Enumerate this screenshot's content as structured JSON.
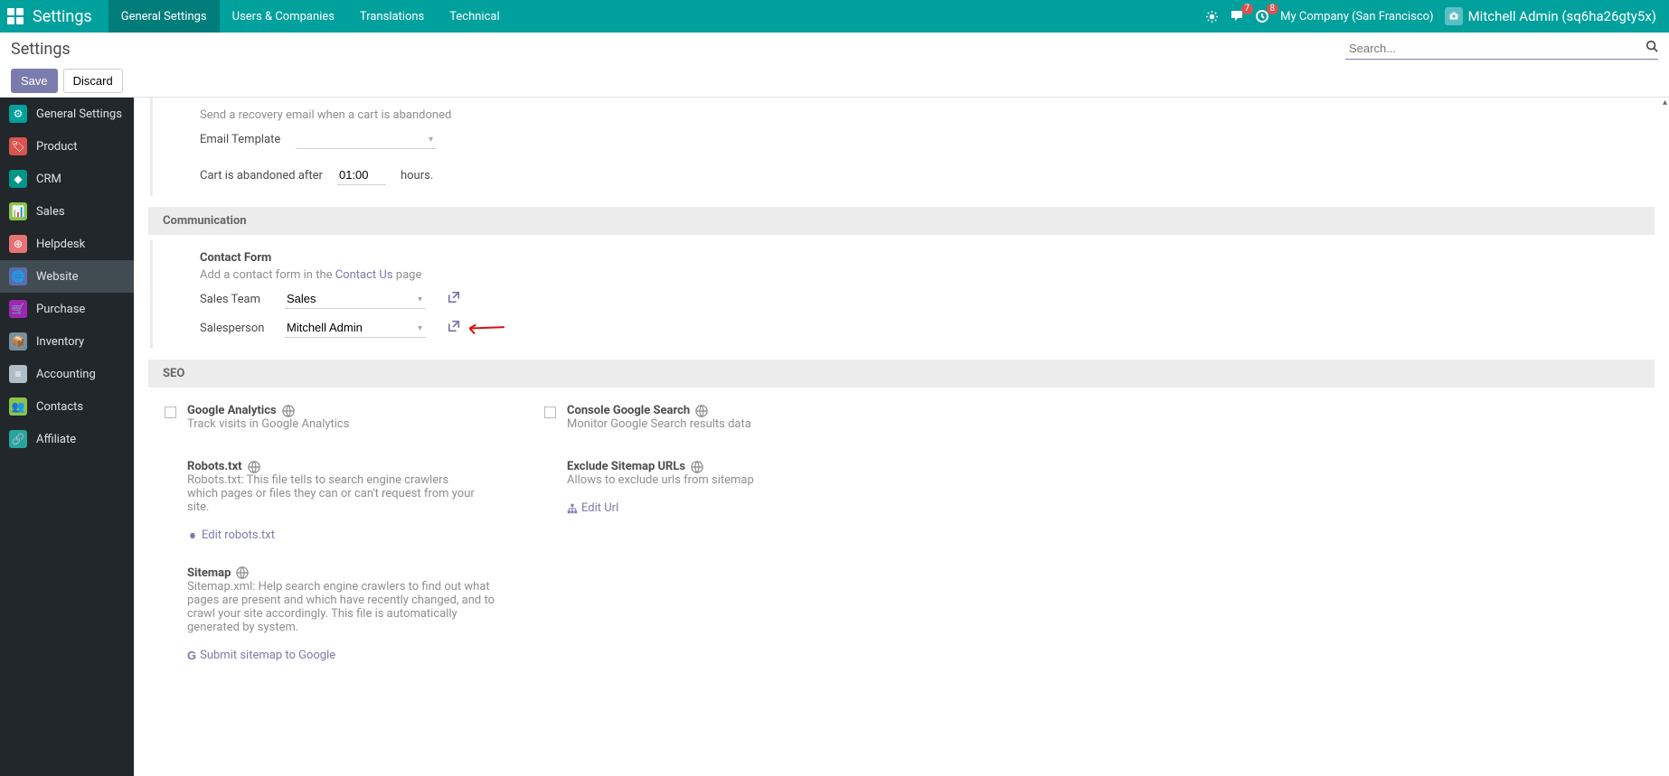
{
  "nav": {
    "brand": "Settings",
    "menu": [
      "General Settings",
      "Users & Companies",
      "Translations",
      "Technical"
    ],
    "active_menu_index": 0,
    "badges": {
      "msg": "7",
      "activity": "8"
    },
    "company": "My Company (San Francisco)",
    "user": "Mitchell Admin (sq6ha26gty5x)"
  },
  "header": {
    "breadcrumb": "Settings",
    "search_placeholder": "Search..."
  },
  "actions": {
    "save": "Save",
    "discard": "Discard"
  },
  "sidebar": {
    "items": [
      {
        "label": "General Settings"
      },
      {
        "label": "Product"
      },
      {
        "label": "CRM"
      },
      {
        "label": "Sales"
      },
      {
        "label": "Helpdesk"
      },
      {
        "label": "Website"
      },
      {
        "label": "Purchase"
      },
      {
        "label": "Inventory"
      },
      {
        "label": "Accounting"
      },
      {
        "label": "Contacts"
      },
      {
        "label": "Affiliate"
      }
    ],
    "active_index": 5
  },
  "abandoned_cart": {
    "desc": "Send a recovery email when a cart is abandoned",
    "email_template_label": "Email Template",
    "email_template_value": "",
    "after_prefix": "Cart is abandoned after",
    "after_value": "01:00",
    "after_suffix": "hours."
  },
  "section_comm": "Communication",
  "contact_form": {
    "title": "Contact Form",
    "desc_prefix": "Add a contact form in the ",
    "desc_link": "Contact Us",
    "desc_suffix": " page",
    "sales_team_label": "Sales Team",
    "sales_team_value": "Sales",
    "salesperson_label": "Salesperson",
    "salesperson_value": "Mitchell Admin"
  },
  "section_seo": "SEO",
  "seo": {
    "ga": {
      "title": "Google Analytics",
      "desc": "Track visits in Google Analytics"
    },
    "robots": {
      "title": "Robots.txt",
      "desc": "Robots.txt: This file tells to search engine crawlers which pages or files they can or can't request from your site.",
      "action": "Edit robots.txt"
    },
    "sitemap": {
      "title": "Sitemap",
      "desc": "Sitemap.xml: Help search engine crawlers to find out what pages are present and which have recently changed, and to crawl your site accordingly. This file is automatically generated by system.",
      "action": "Submit sitemap to Google"
    },
    "gsc": {
      "title": "Console Google Search",
      "desc": "Monitor Google Search results data"
    },
    "exclude": {
      "title": "Exclude Sitemap URLs",
      "desc": "Allows to exclude urls from sitemap",
      "action": "Edit Url"
    }
  }
}
